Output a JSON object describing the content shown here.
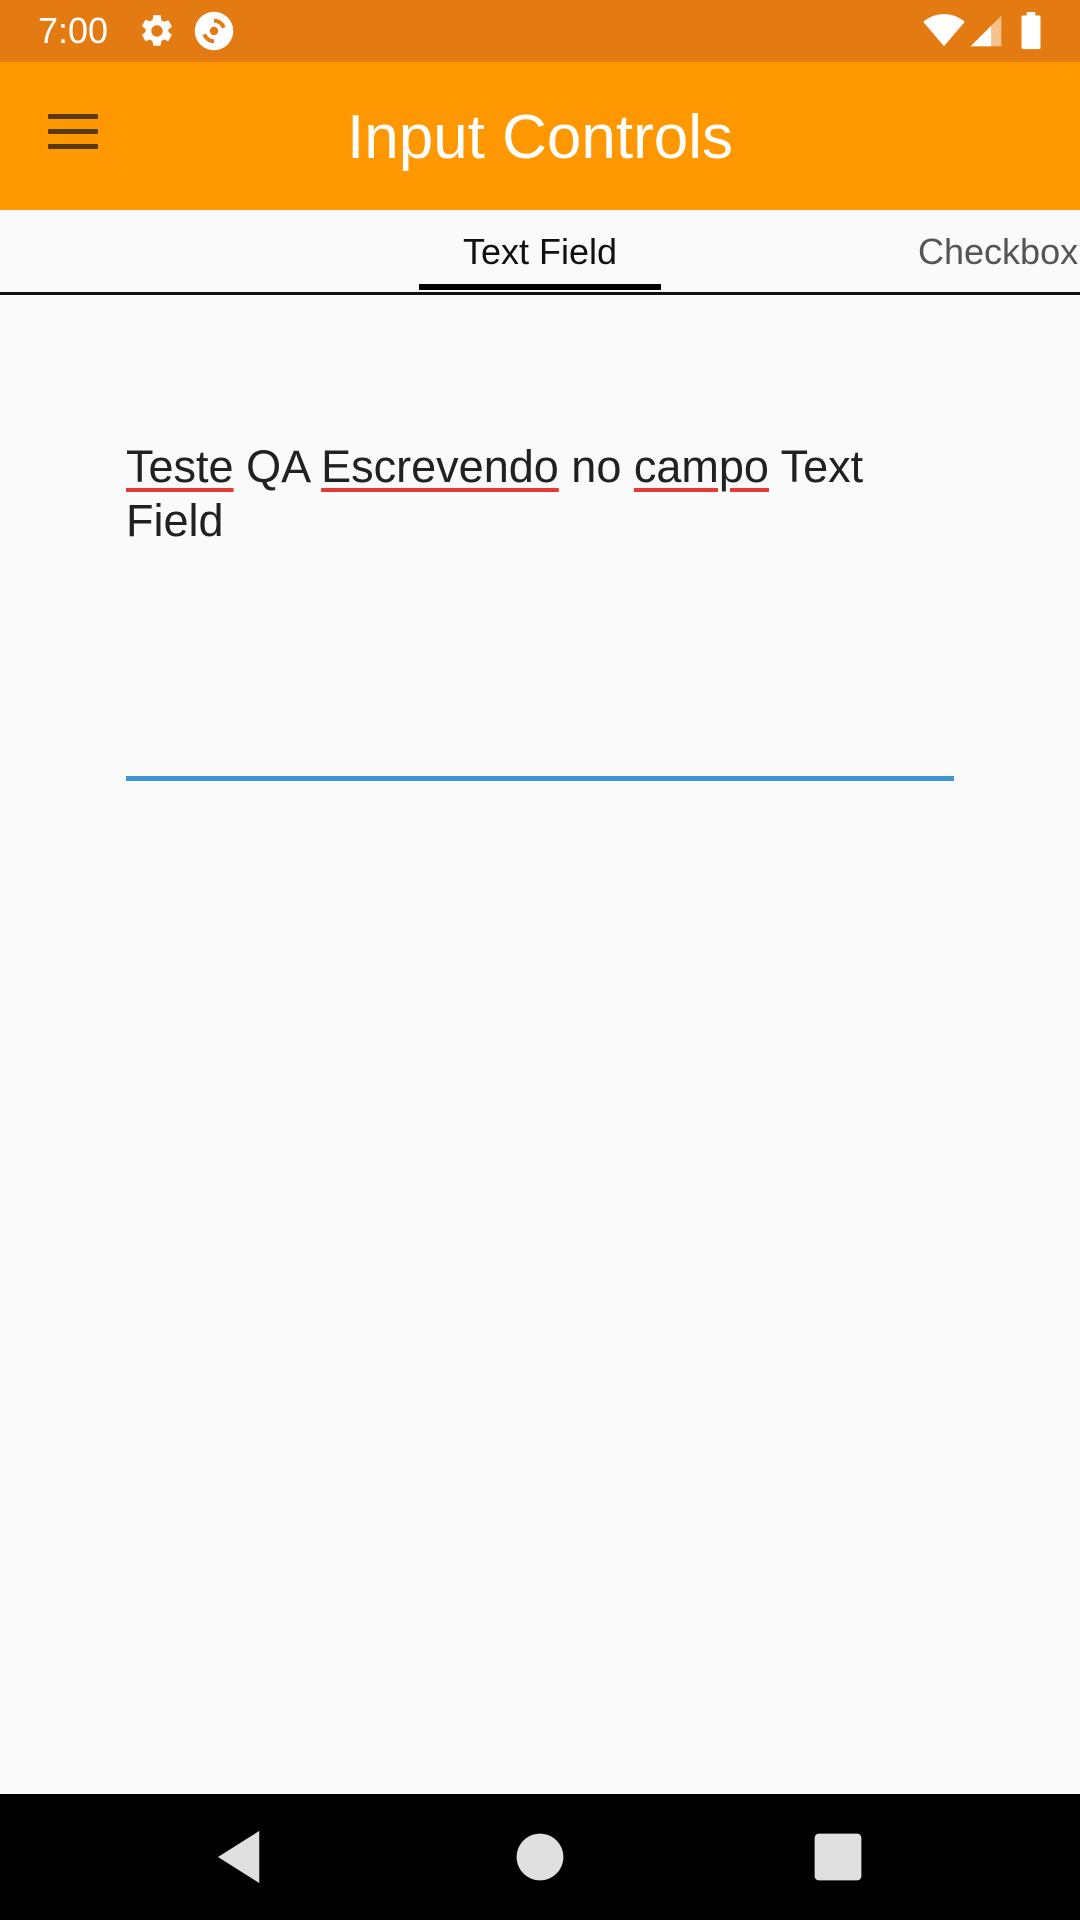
{
  "status_bar": {
    "time": "7:00",
    "background": "#e47a12",
    "icons": [
      "settings-icon",
      "sync-icon",
      "wifi-icon",
      "cell-signal-icon",
      "battery-icon"
    ]
  },
  "app_bar": {
    "title": "Input Controls",
    "background": "#ff9800",
    "menu_icon": "hamburger-menu-icon"
  },
  "tabs": {
    "items": [
      {
        "label": "Text Field",
        "selected": true
      },
      {
        "label": "Checkbox",
        "selected": false
      }
    ]
  },
  "text_field": {
    "words": [
      "Teste",
      "QA",
      "Escrevendo",
      "no",
      "campo",
      "Text",
      "Field"
    ],
    "misspelled": [
      true,
      false,
      true,
      false,
      true,
      false,
      false
    ],
    "underline_color": "#3d95d1",
    "spellcheck_color": "#e53935"
  },
  "nav_bar": {
    "buttons": [
      "back-icon",
      "home-icon",
      "recents-icon"
    ]
  }
}
